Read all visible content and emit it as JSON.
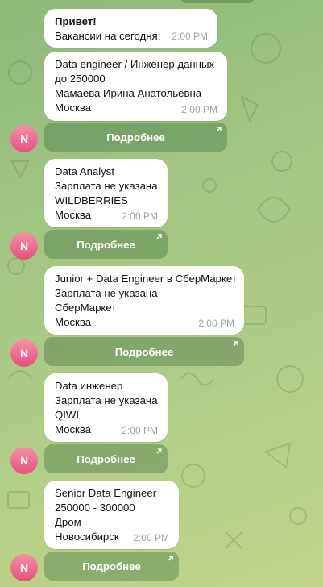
{
  "messages": [
    {
      "lines": [
        "Привет!",
        "Вакансии на сегодня:"
      ],
      "bold_first": true,
      "time": "2:00 PM"
    },
    {
      "lines": [
        "Data engineer / Инженер данных",
        "до 250000",
        "Мамаева Ирина Анатольевна",
        "Москва"
      ],
      "time": "2:00 PM",
      "button_label": "Подробнее"
    },
    {
      "lines": [
        "Data Analyst",
        "Зарплата не указана",
        "WILDBERRIES",
        "Москва"
      ],
      "time": "2:00 PM",
      "button_label": "Подробнее"
    },
    {
      "lines": [
        "Junior + Data Engineer в СберМаркет",
        "Зарплата не указана",
        "СберМаркет",
        "Москва"
      ],
      "time": "2:00 PM",
      "button_label": "Подробнее"
    },
    {
      "lines": [
        "Data инженер",
        "Зарплата не указана",
        "QIWI",
        "Москва"
      ],
      "time": "2:00 PM",
      "button_label": "Подробнее"
    },
    {
      "lines": [
        "Senior Data Engineer",
        "250000 - 300000",
        "Дром",
        "Новосибирск"
      ],
      "time": "2:00 PM",
      "button_label": "Подробнее"
    }
  ],
  "avatar_letter": "N",
  "colors": {
    "avatar": "#e5527a",
    "bubble": "#ffffff",
    "button_overlay": "rgba(64,110,62,0.38)"
  },
  "icons": {
    "button_icon": "external-link-arrow-icon"
  }
}
